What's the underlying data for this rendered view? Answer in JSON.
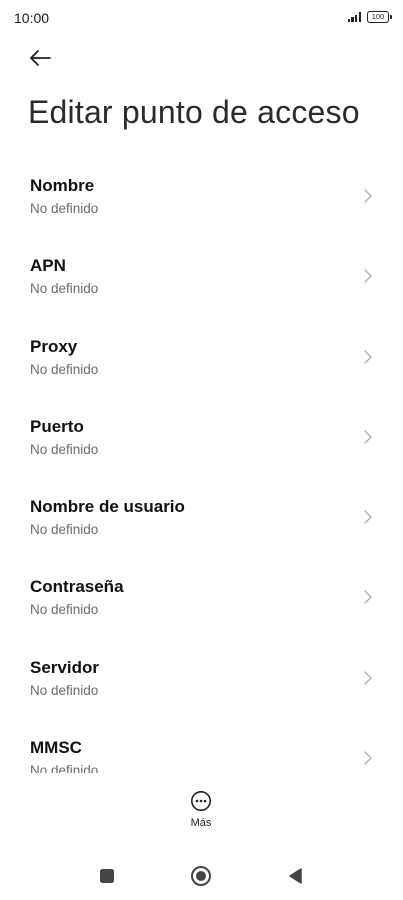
{
  "status_bar": {
    "time": "10:00",
    "battery": "100"
  },
  "header": {
    "title": "Editar punto de acceso"
  },
  "fields": [
    {
      "label": "Nombre",
      "value": "No definido"
    },
    {
      "label": "APN",
      "value": "No definido"
    },
    {
      "label": "Proxy",
      "value": "No definido"
    },
    {
      "label": "Puerto",
      "value": "No definido"
    },
    {
      "label": "Nombre de usuario",
      "value": "No definido"
    },
    {
      "label": "Contraseña",
      "value": "No definido"
    },
    {
      "label": "Servidor",
      "value": "No definido"
    },
    {
      "label": "MMSC",
      "value": "No definido"
    }
  ],
  "footer": {
    "more_label": "Más"
  },
  "icons": {
    "back": "arrow-left-icon",
    "chevron": "chevron-right-icon",
    "more": "more-horizontal-icon",
    "nav_recents": "square-icon",
    "nav_home": "circle-icon",
    "nav_back": "triangle-left-icon"
  },
  "colors": {
    "background": "#ffffff",
    "text_primary": "#111111",
    "text_secondary": "#6b6b6b",
    "chevron": "#b5b5b5"
  }
}
